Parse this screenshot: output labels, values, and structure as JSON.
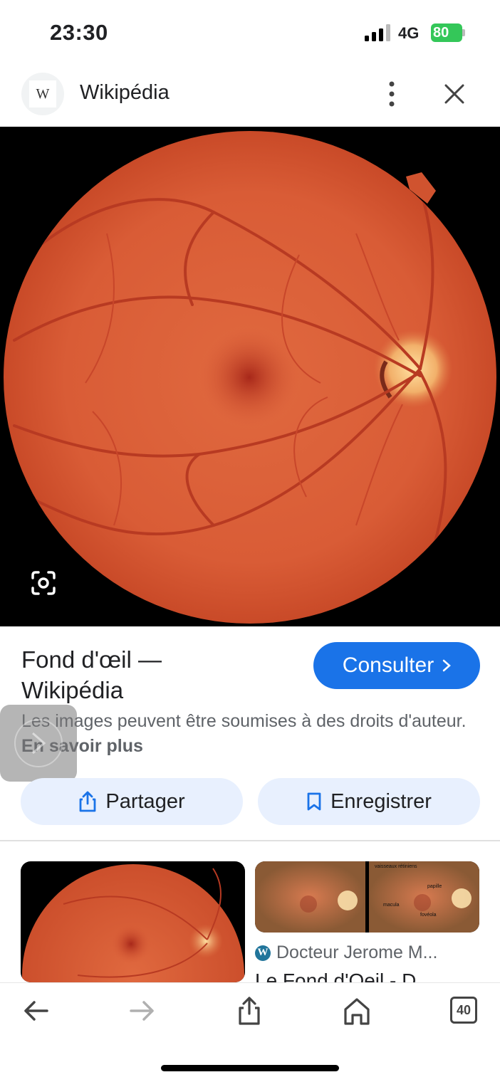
{
  "status_bar": {
    "time": "23:30",
    "network": "4G",
    "battery": "80"
  },
  "header": {
    "site_logo_letter": "W",
    "site_name": "Wikipédia"
  },
  "result": {
    "title_line1": "Fond d'œil —",
    "title_line2": "Wikipédia",
    "consult_label": "Consulter",
    "notice_text": "Les images peuvent être soumises à des droits d'auteur.",
    "notice_link": "En savoir plus",
    "share_label": "Partager",
    "save_label": "Enregistrer"
  },
  "related": {
    "source_icon": "W",
    "source_name": "Docteur Jerome M...",
    "title": "Le Fond d'Oeil - D...",
    "annotations": [
      "vaisseaux rétiniens",
      "papille",
      "macula",
      "fovéola"
    ]
  },
  "toolbar": {
    "tab_count": "40"
  },
  "colors": {
    "accent": "#1a73e8",
    "pill_bg": "#e8f0fe",
    "battery": "#34c759"
  }
}
